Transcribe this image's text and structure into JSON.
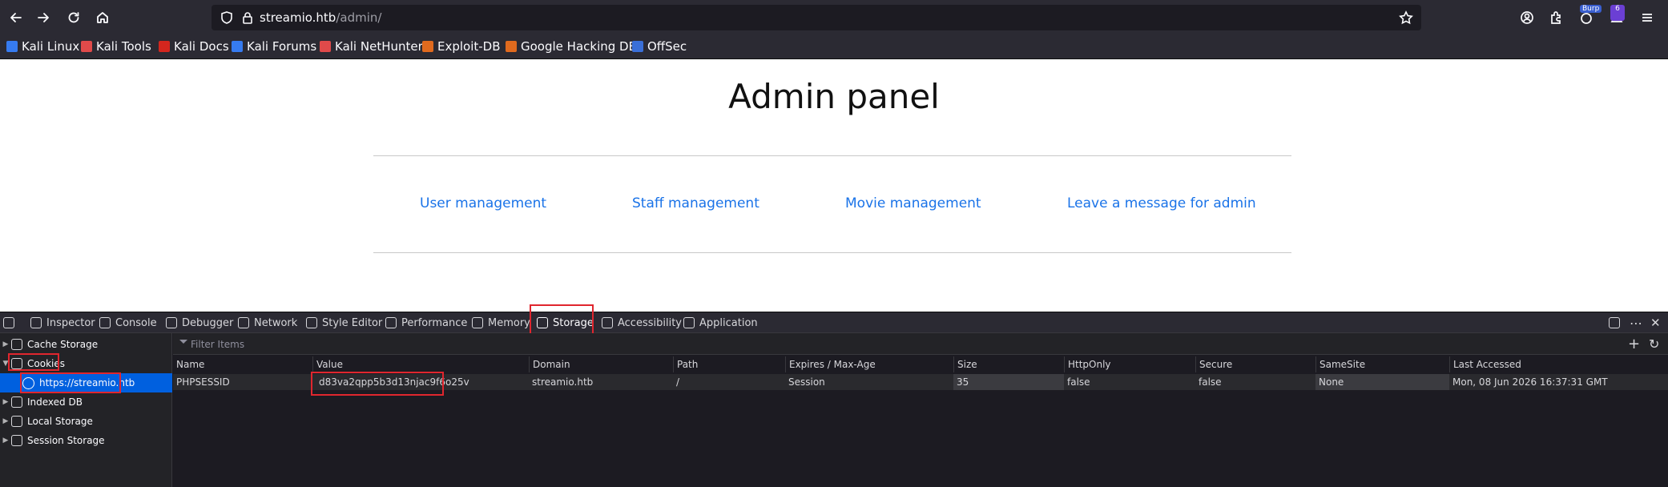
{
  "browser": {
    "url_host": "streamio.htb",
    "url_path": "/admin/",
    "burp_label": "Burp",
    "ext_count": "6"
  },
  "bookmarks": [
    {
      "label": "Kali Linux",
      "color": "#367bf0"
    },
    {
      "label": "Kali Tools",
      "color": "#e04a4a"
    },
    {
      "label": "Kali Docs",
      "color": "#d4261e"
    },
    {
      "label": "Kali Forums",
      "color": "#367bf0"
    },
    {
      "label": "Kali NetHunter",
      "color": "#e04a4a"
    },
    {
      "label": "Exploit-DB",
      "color": "#e06a1e"
    },
    {
      "label": "Google Hacking DB",
      "color": "#e06a1e"
    },
    {
      "label": "OffSec",
      "color": "#3a6fd8"
    }
  ],
  "page": {
    "title": "Admin panel",
    "links": [
      "User management",
      "Staff management",
      "Movie management",
      "Leave a message for admin"
    ]
  },
  "devtools": {
    "tabs": [
      "Inspector",
      "Console",
      "Debugger",
      "Network",
      "Style Editor",
      "Performance",
      "Memory",
      "Storage",
      "Accessibility",
      "Application"
    ],
    "active_tab": "Storage",
    "sidebar": {
      "cache_storage": "Cache Storage",
      "cookies": "Cookies",
      "cookie_origin": "https://streamio.htb",
      "indexed_db": "Indexed DB",
      "local_storage": "Local Storage",
      "session_storage": "Session Storage"
    },
    "filter_placeholder": "Filter Items",
    "columns": [
      "Name",
      "Value",
      "Domain",
      "Path",
      "Expires / Max-Age",
      "Size",
      "HttpOnly",
      "Secure",
      "SameSite",
      "Last Accessed"
    ],
    "rows": [
      [
        "PHPSESSID",
        "d83va2qpp5b3d13njac9f6o25v",
        "streamio.htb",
        "/",
        "Session",
        "35",
        "false",
        "false",
        "None",
        "Mon, 08 Jun 2026 16:37:31 GMT"
      ]
    ]
  },
  "colors": {
    "highlight": "#e0262e",
    "link": "#1a73e8",
    "selection": "#0060df"
  }
}
